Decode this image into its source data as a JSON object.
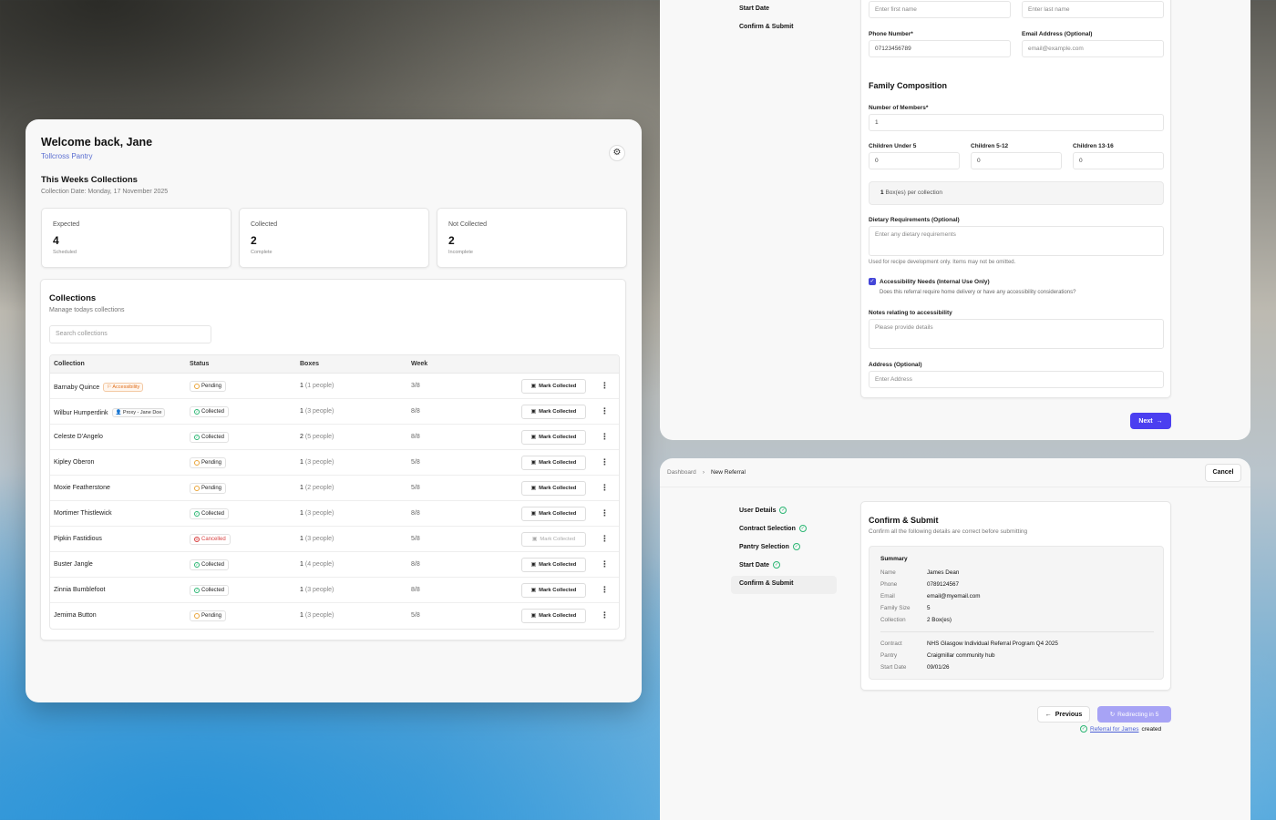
{
  "dashboard": {
    "title": "Welcome back, Jane",
    "pantry": "Tollcross Pantry",
    "section_title": "This Weeks Collections",
    "collection_date": "Collection Date: Monday, 17 November 2025",
    "stats": [
      {
        "label": "Expected",
        "value": "4",
        "caption": "Scheduled"
      },
      {
        "label": "Collected",
        "value": "2",
        "caption": "Complete"
      },
      {
        "label": "Not Collected",
        "value": "2",
        "caption": "Incomplete"
      }
    ],
    "collections": {
      "title": "Collections",
      "subtitle": "Manage todays collections",
      "search_placeholder": "Search collections",
      "columns": [
        "Collection",
        "Status",
        "Boxes",
        "Week"
      ],
      "mark_label": "Mark Collected",
      "rows": [
        {
          "name": "Barnaby Quince",
          "tag": "Accessibility",
          "status": "Pending",
          "boxes": "1",
          "people": "(1 people)",
          "week": "3/8"
        },
        {
          "name": "Wilbur Humperdink",
          "tag": "Proxy - Jane Doe",
          "status": "Collected",
          "boxes": "1",
          "people": "(3 people)",
          "week": "8/8"
        },
        {
          "name": "Celeste D'Angelo",
          "status": "Collected",
          "boxes": "2",
          "people": "(5 people)",
          "week": "8/8"
        },
        {
          "name": "Kipley Oberon",
          "status": "Pending",
          "boxes": "1",
          "people": "(3 people)",
          "week": "5/8"
        },
        {
          "name": "Moxie Featherstone",
          "status": "Pending",
          "boxes": "1",
          "people": "(2 people)",
          "week": "5/8"
        },
        {
          "name": "Mortimer Thistlewick",
          "status": "Collected",
          "boxes": "1",
          "people": "(3 people)",
          "week": "8/8"
        },
        {
          "name": "Pipkin Fastidious",
          "status": "Cancelled",
          "boxes": "1",
          "people": "(3 people)",
          "week": "5/8"
        },
        {
          "name": "Buster Jangle",
          "status": "Collected",
          "boxes": "1",
          "people": "(4 people)",
          "week": "8/8"
        },
        {
          "name": "Zinnia Bumblefoot",
          "status": "Collected",
          "boxes": "1",
          "people": "(3 people)",
          "week": "8/8"
        },
        {
          "name": "Jemima Button",
          "status": "Pending",
          "boxes": "1",
          "people": "(3 people)",
          "week": "5/8"
        }
      ]
    }
  },
  "referral_form": {
    "steps": [
      "Start Date",
      "Confirm & Submit"
    ],
    "first_name_placeholder": "Enter first name",
    "last_name_placeholder": "Enter last name",
    "phone_label": "Phone Number*",
    "phone_value": "07123456789",
    "email_label": "Email Address (Optional)",
    "email_placeholder": "email@example.com",
    "family_heading": "Family Composition",
    "members_label": "Number of Members*",
    "members_value": "1",
    "children_under5_label": "Children Under 5",
    "children_5_12_label": "Children 5-12",
    "children_13_16_label": "Children 13-16",
    "children_under5_value": "0",
    "children_5_12_value": "0",
    "children_13_16_value": "0",
    "box_count": "1",
    "box_text": "Box(es) per collection",
    "dietary_label": "Dietary Requirements (Optional)",
    "dietary_placeholder": "Enter any dietary requirements",
    "dietary_note": "Used for recipe development only. Items may not be omitted.",
    "accessibility_label": "Accessibility Needs (Internal Use Only)",
    "accessibility_desc": "Does this referral require home delivery or have any accessibility considerations?",
    "notes_label": "Notes relating to accessibility",
    "notes_placeholder": "Please provide details",
    "address_label": "Address (Optional)",
    "address_placeholder": "Enter Address",
    "next_label": "Next"
  },
  "confirm": {
    "breadcrumb": [
      "Dashboard",
      "New Referral"
    ],
    "cancel_label": "Cancel",
    "steps": [
      "User Details",
      "Contract Selection",
      "Pantry Selection",
      "Start Date",
      "Confirm & Submit"
    ],
    "title": "Confirm & Submit",
    "subtitle": "Confirm all the following details are correct before submitting",
    "summary_heading": "Summary",
    "summary": [
      {
        "k": "Name",
        "v": "James Dean"
      },
      {
        "k": "Phone",
        "v": "0789124567"
      },
      {
        "k": "Email",
        "v": "email@myemail.com"
      },
      {
        "k": "Family Size",
        "v": "5"
      },
      {
        "k": "Collection",
        "v": "2 Box(es)"
      }
    ],
    "summary2": [
      {
        "k": "Contract",
        "v": "NHS Glasgow Individual Referral Program Q4 2025"
      },
      {
        "k": "Pantry",
        "v": "Craigmillar community hub"
      },
      {
        "k": "Start Date",
        "v": "09/01/26"
      }
    ],
    "previous_label": "Previous",
    "redirect_label": "Redirecting in 5",
    "created_link": "Referral for James",
    "created_suffix": "created"
  }
}
